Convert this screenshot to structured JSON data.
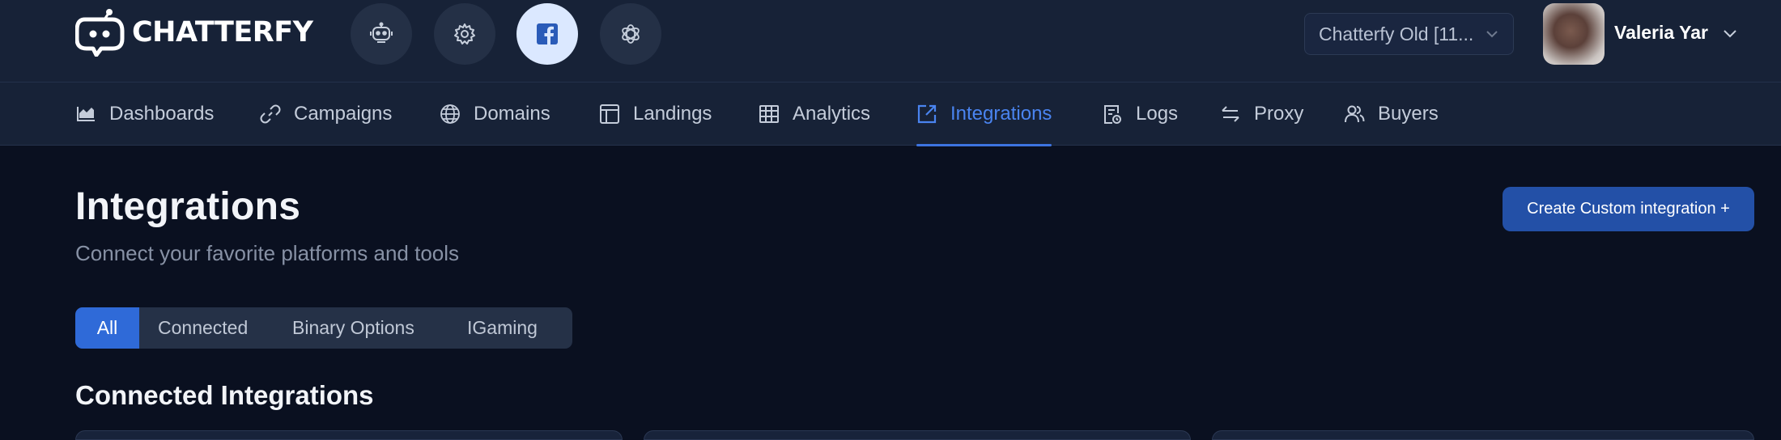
{
  "brand": {
    "name": "CHATTERFY"
  },
  "top_buttons": [
    {
      "icon": "robot-icon"
    },
    {
      "icon": "gear-icon"
    },
    {
      "icon": "facebook-icon"
    },
    {
      "icon": "openai-icon"
    }
  ],
  "project_select": {
    "value": "Chatterfy Old [11..."
  },
  "user": {
    "name": "Valeria Yar"
  },
  "nav": {
    "items": [
      {
        "label": "Dashboards",
        "icon": "chart-icon"
      },
      {
        "label": "Campaigns",
        "icon": "link-icon"
      },
      {
        "label": "Domains",
        "icon": "globe-icon"
      },
      {
        "label": "Landings",
        "icon": "layout-icon"
      },
      {
        "label": "Analytics",
        "icon": "table-icon"
      },
      {
        "label": "Integrations",
        "icon": "external-link-icon"
      },
      {
        "label": "Logs",
        "icon": "document-icon"
      },
      {
        "label": "Proxy",
        "icon": "arrows-icon"
      },
      {
        "label": "Buyers",
        "icon": "users-icon"
      }
    ]
  },
  "page": {
    "title": "Integrations",
    "subtitle": "Connect your favorite platforms and tools",
    "create_button": "Create Custom integration +"
  },
  "filters": {
    "tabs": [
      {
        "label": "All"
      },
      {
        "label": "Connected"
      },
      {
        "label": "Binary Options"
      },
      {
        "label": "IGaming"
      }
    ]
  },
  "sections": {
    "connected_title": "Connected Integrations"
  },
  "colors": {
    "background": "#0a1020",
    "header": "#172237",
    "accent": "#2f6ad8",
    "active_nav": "#4a84f0",
    "button": "#2350a7"
  }
}
